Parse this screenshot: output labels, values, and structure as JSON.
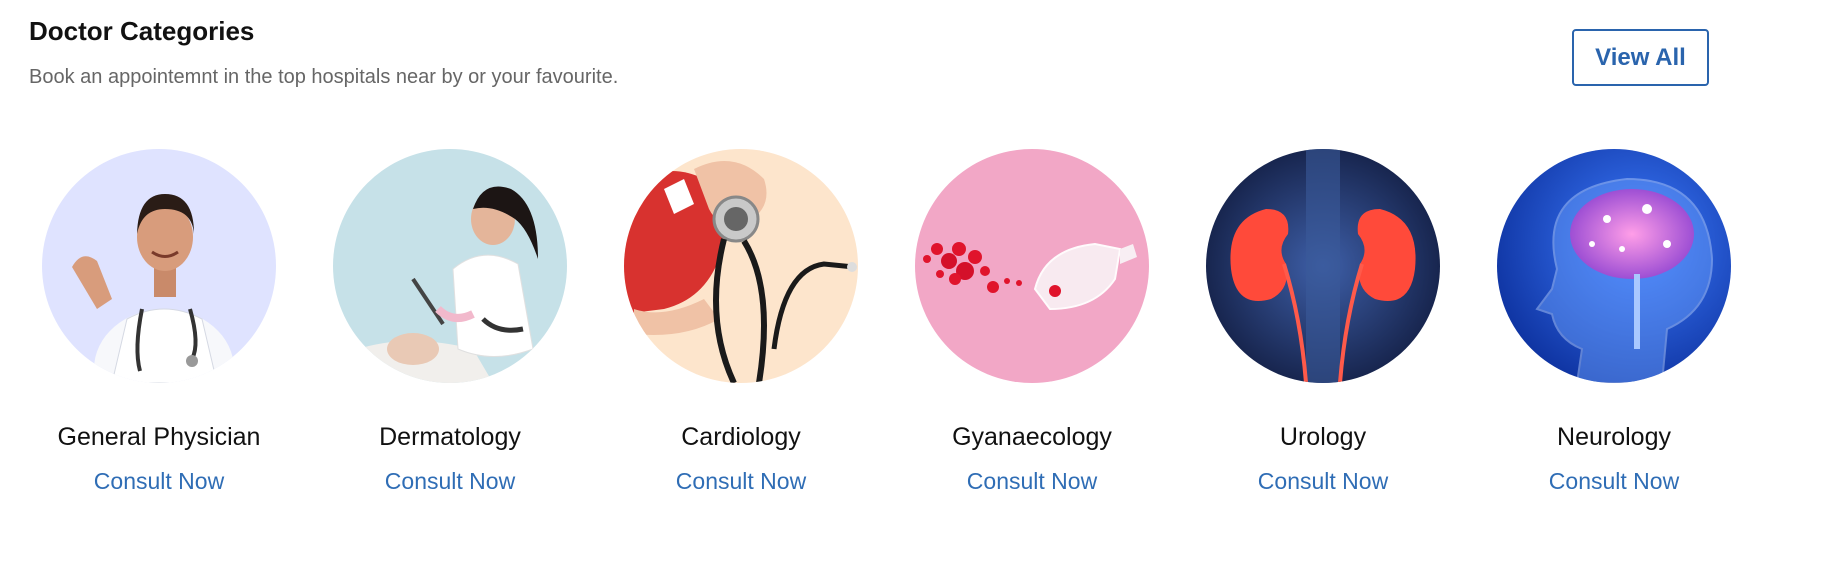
{
  "header": {
    "title": "Doctor Categories",
    "subtitle": "Book an appointemnt in the top hospitals near by or your favourite.",
    "view_all_label": "View All"
  },
  "colors": {
    "accent": "#2a64ad",
    "link": "#2f6db5"
  },
  "categories": [
    {
      "name": "General Physician",
      "action": "Consult Now",
      "image": "doctor-illustration",
      "bg": "#dfe3ff"
    },
    {
      "name": "Dermatology",
      "action": "Consult Now",
      "image": "dermatologist-illustration",
      "bg": "#c6e1e8"
    },
    {
      "name": "Cardiology",
      "action": "Consult Now",
      "image": "stethoscope-heart-illustration",
      "bg": "#fde5cc"
    },
    {
      "name": "Gyanaecology",
      "action": "Consult Now",
      "image": "menstrual-cup-illustration",
      "bg": "#f2a7c6"
    },
    {
      "name": "Urology",
      "action": "Consult Now",
      "image": "kidneys-illustration",
      "bg": "#1b2a5c"
    },
    {
      "name": "Neurology",
      "action": "Consult Now",
      "image": "brain-illustration",
      "bg": "#1347b8"
    }
  ]
}
